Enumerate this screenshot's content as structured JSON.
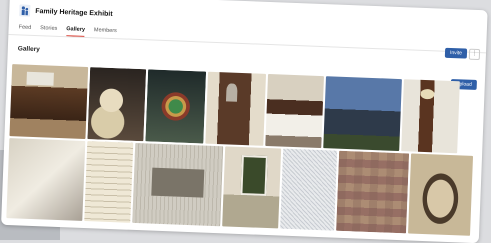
{
  "app": {
    "title": "Family Heritage Exhibit"
  },
  "tabs": [
    {
      "label": "Feed"
    },
    {
      "label": "Stories"
    },
    {
      "label": "Gallery"
    },
    {
      "label": "Members"
    }
  ],
  "active_tab": "Gallery",
  "header_actions": {
    "invite_label": "Invite",
    "more_label": "⋮"
  },
  "gallery": {
    "title": "Gallery",
    "upload_label": "Upload",
    "rows": [
      [
        "desk",
        "stuffed-bear",
        "stained-glass",
        "dresser",
        "bed",
        "old-house",
        "grandfather-clock"
      ],
      [
        "linen",
        "old-letter",
        "engraving",
        "window",
        "lace",
        "quilt",
        "framed-portrait"
      ]
    ]
  },
  "colors": {
    "accent": "#2f5fa8",
    "active_tab_underline": "#d9372b"
  }
}
